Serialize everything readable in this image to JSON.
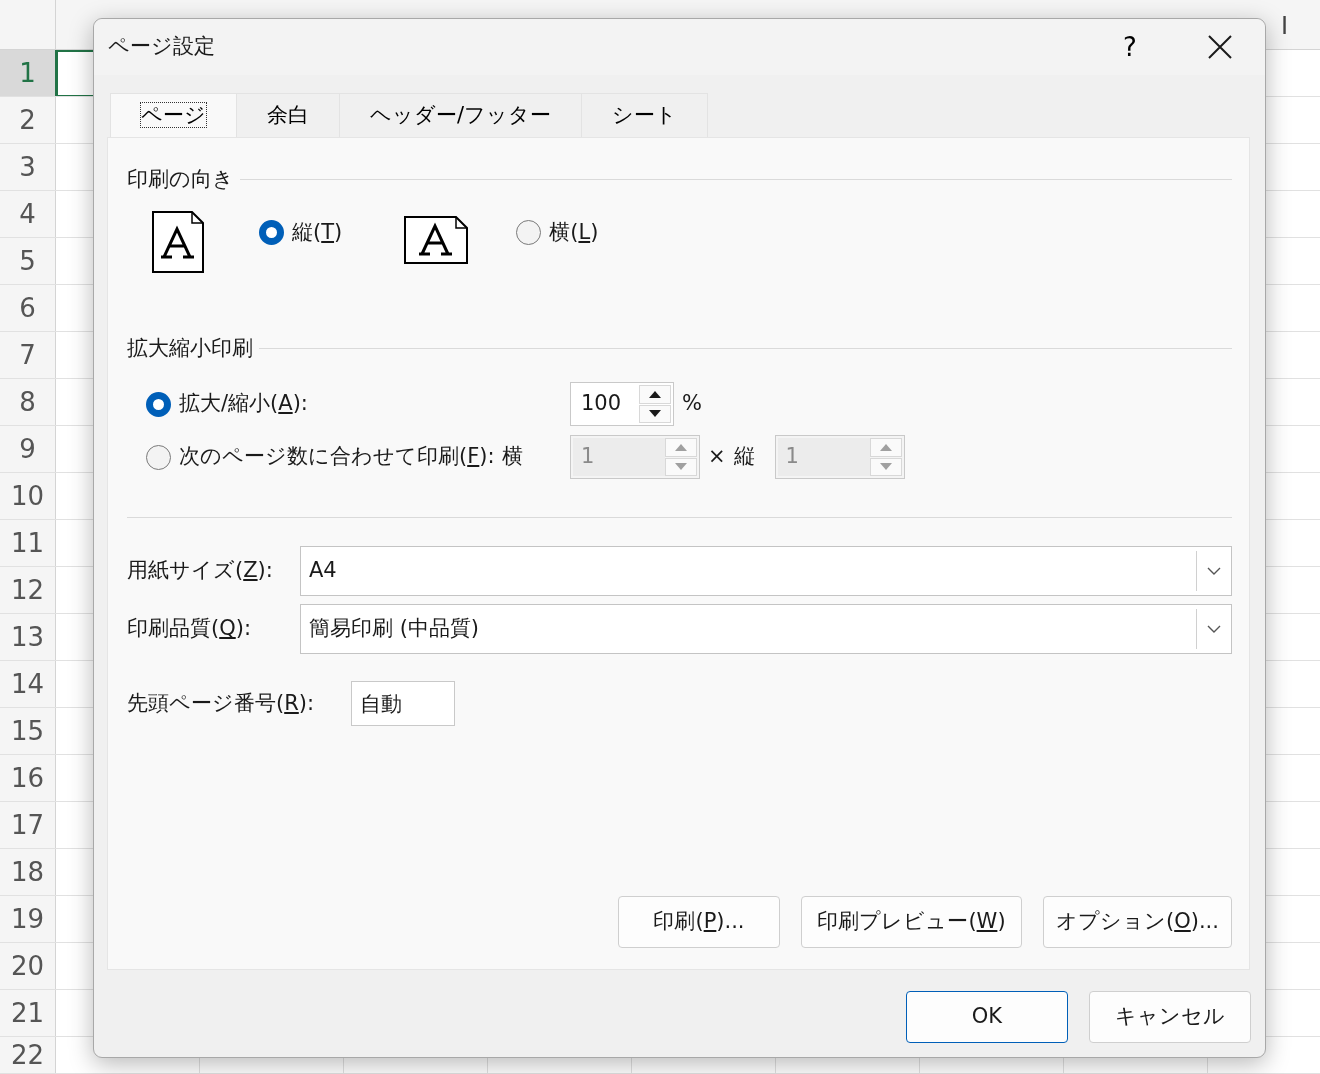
{
  "spreadsheet": {
    "column_headers": [
      "I"
    ],
    "row_headers": [
      {
        "label": "1",
        "selected": true
      },
      {
        "label": "2",
        "selected": false
      },
      {
        "label": "3",
        "selected": false
      },
      {
        "label": "4",
        "selected": false
      },
      {
        "label": "5",
        "selected": false
      },
      {
        "label": "6",
        "selected": false
      },
      {
        "label": "7",
        "selected": false
      },
      {
        "label": "8",
        "selected": false
      },
      {
        "label": "9",
        "selected": false
      },
      {
        "label": "10",
        "selected": false
      },
      {
        "label": "11",
        "selected": false
      },
      {
        "label": "12",
        "selected": false
      },
      {
        "label": "13",
        "selected": false
      },
      {
        "label": "14",
        "selected": false
      },
      {
        "label": "15",
        "selected": false
      },
      {
        "label": "16",
        "selected": false
      },
      {
        "label": "17",
        "selected": false
      },
      {
        "label": "18",
        "selected": false
      },
      {
        "label": "19",
        "selected": false
      },
      {
        "label": "20",
        "selected": false
      },
      {
        "label": "21",
        "selected": false
      },
      {
        "label": "22",
        "selected": false
      }
    ]
  },
  "dialog": {
    "title": "ページ設定",
    "help": "?",
    "tabs": [
      {
        "label": "ページ",
        "selected": true
      },
      {
        "label": "余白",
        "selected": false
      },
      {
        "label": "ヘッダー/フッター",
        "selected": false
      },
      {
        "label": "シート",
        "selected": false
      }
    ],
    "orientation": {
      "heading": "印刷の向き",
      "options": [
        {
          "kind": "portrait",
          "label": "縦(",
          "access_key": "T",
          "label_end": ")",
          "selected": true
        },
        {
          "kind": "landscape",
          "label": "横(",
          "access_key": "L",
          "label_end": ")",
          "selected": false
        }
      ]
    },
    "scaling": {
      "heading": "拡大縮小印刷",
      "options": [
        {
          "kind": "percent",
          "label": "拡大/縮小(",
          "access_key": "A",
          "label_end": "):",
          "selected": true,
          "value": "100",
          "unit": "%",
          "disabled": false
        },
        {
          "kind": "fit",
          "label": "次のページ数に合わせて印刷(",
          "access_key": "F",
          "label_end": "):",
          "selected": false,
          "wide_label": "横",
          "wide_value": "1",
          "separator": "×",
          "tall_label": "縦",
          "tall_value": "1",
          "disabled": true
        }
      ]
    },
    "selects": [
      {
        "label": "用紙サイズ(",
        "access_key": "Z",
        "label_end": "):",
        "value": "A4"
      },
      {
        "label": "印刷品質(",
        "access_key": "Q",
        "label_end": "):",
        "value": "簡易印刷 (中品質)"
      }
    ],
    "first_page_number": {
      "label": "先頭ページ番号(",
      "access_key": "R",
      "label_end": "):",
      "value": "自動"
    },
    "panel_buttons": [
      {
        "label": "印刷(",
        "access_key": "P",
        "label_end": ")..."
      },
      {
        "label": "印刷プレビュー(",
        "access_key": "W",
        "label_end": ")"
      },
      {
        "label": "オプション(",
        "access_key": "O",
        "label_end": ")..."
      }
    ],
    "footer_buttons": [
      {
        "label": "OK",
        "default": true
      },
      {
        "label": "キャンセル",
        "default": false
      }
    ]
  }
}
